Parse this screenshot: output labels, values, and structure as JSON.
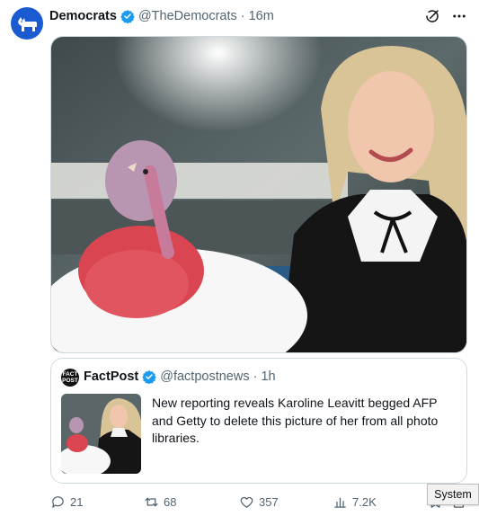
{
  "tweet": {
    "author_name": "Democrats",
    "author_handle": "@TheDemocrats",
    "separator": "·",
    "time": "16m",
    "avatar_icon": "donkey-logo-icon",
    "verified_icon": "verified-badge-icon",
    "brand_color": "#1a5bd1",
    "verified_color": "#1d9bf0"
  },
  "top_actions": {
    "grok_icon": "grok-icon",
    "more_icon": "more-icon"
  },
  "media": {
    "subject": "photo-of-turkey-and-woman"
  },
  "quote": {
    "avatar_text": "FACT POST",
    "author_name": "FactPost",
    "author_handle": "@factpostnews",
    "separator": "·",
    "time": "1h",
    "text": "New reporting reveals Karoline Leavitt begged AFP and Getty to delete this picture of her from all photo libraries."
  },
  "actions": {
    "reply_count": "21",
    "repost_count": "68",
    "like_count": "357",
    "views_count": "7.2K",
    "reply_icon": "reply-icon",
    "repost_icon": "repost-icon",
    "like_icon": "heart-icon",
    "views_icon": "views-icon",
    "bookmark_icon": "bookmark-icon"
  },
  "tooltip": {
    "text": "System"
  }
}
